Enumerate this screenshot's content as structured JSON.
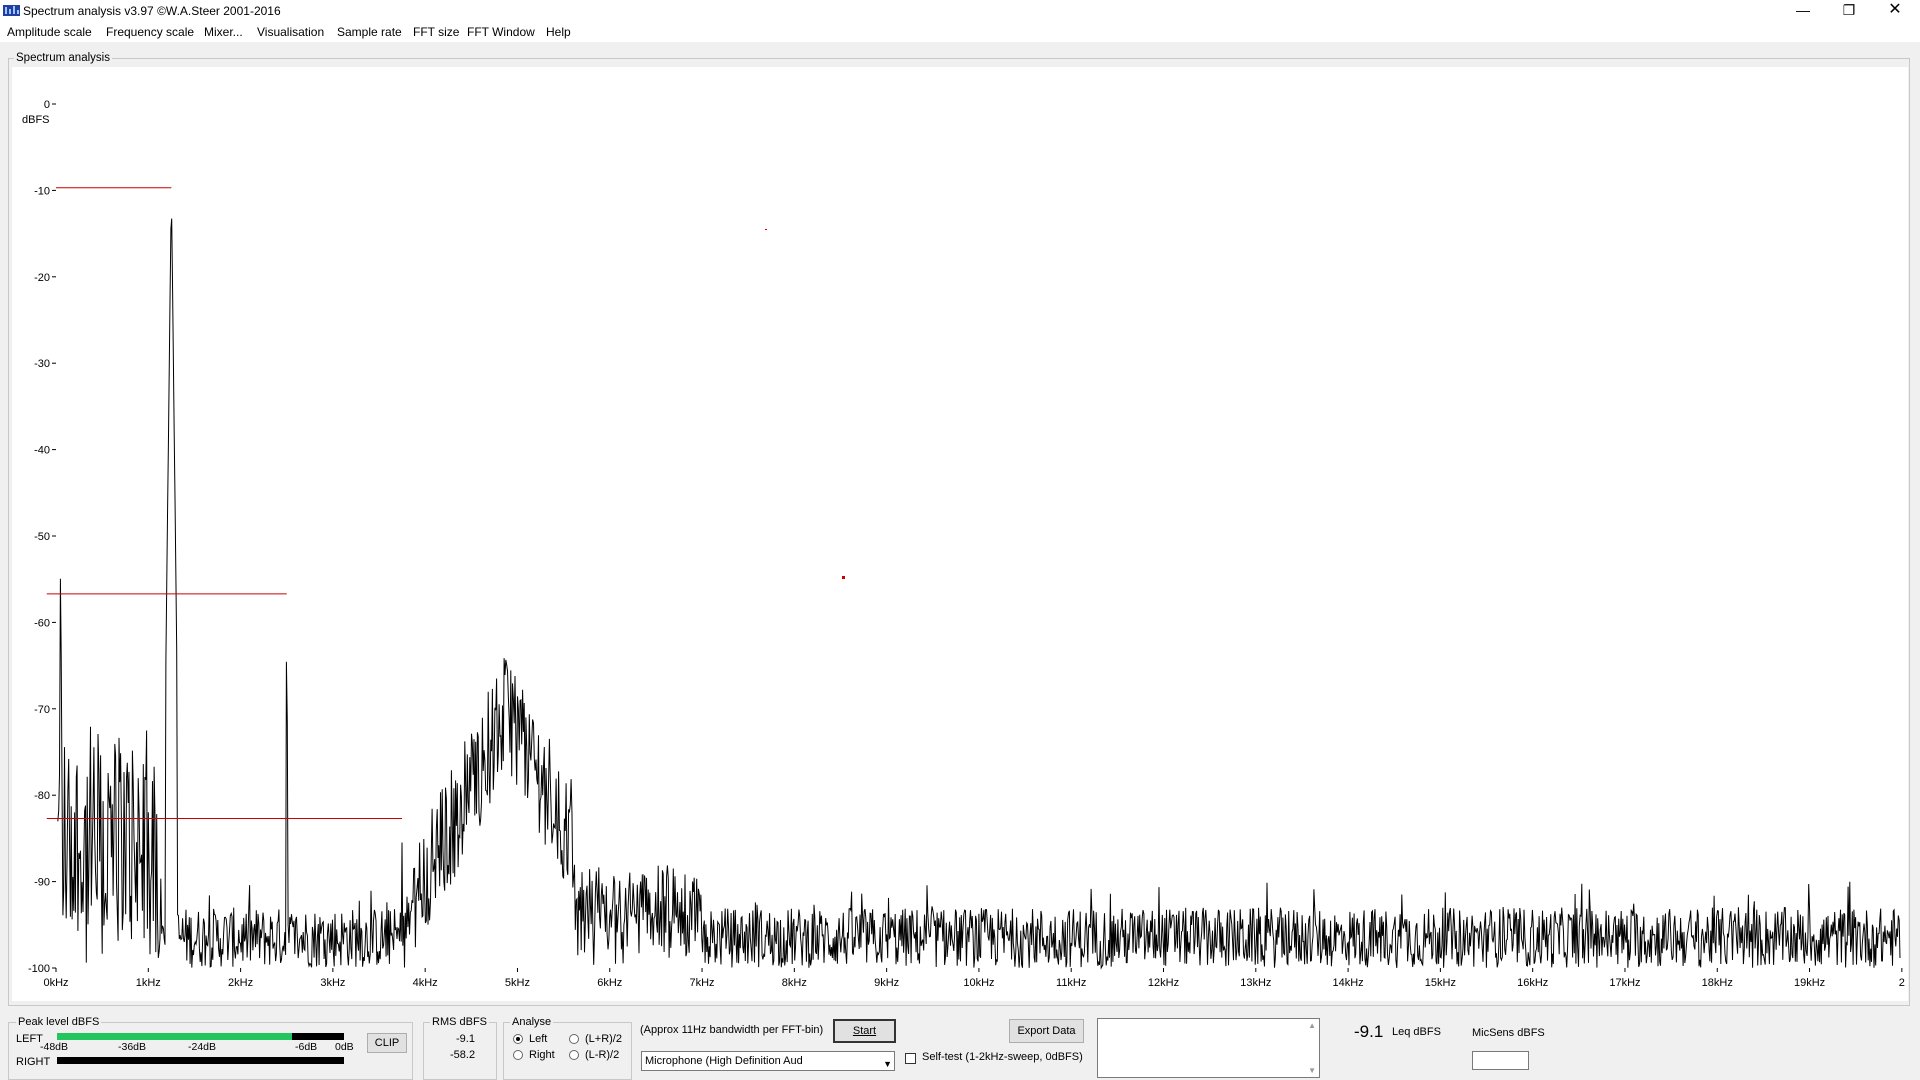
{
  "window": {
    "title": "Spectrum analysis v3.97  ©W.A.Steer 2001-2016",
    "minimize_glyph": "—",
    "maximize_glyph": "❐",
    "close_glyph": "✕"
  },
  "menu": [
    "Amplitude scale",
    "Frequency scale",
    "Mixer...",
    "Visualisation",
    "Sample rate",
    "FFT size",
    "FFT Window",
    "Help"
  ],
  "spectrum_panel": {
    "label": "Spectrum analysis"
  },
  "chart_data": {
    "type": "line",
    "ylabel": "dBFS",
    "ylim": [
      -100,
      0
    ],
    "xlim_khz": [
      0,
      20
    ],
    "y_ticks": [
      "0",
      "-10",
      "-20",
      "-30",
      "-40",
      "-50",
      "-60",
      "-70",
      "-80",
      "-90",
      "-100"
    ],
    "x_ticks": [
      "0kHz",
      "1kHz",
      "2kHz",
      "3kHz",
      "4kHz",
      "5kHz",
      "6kHz",
      "7kHz",
      "8kHz",
      "9kHz",
      "10kHz",
      "11kHz",
      "12kHz",
      "13kHz",
      "14kHz",
      "15kHz",
      "16kHz",
      "17kHz",
      "18kHz",
      "19kHz",
      "2"
    ],
    "peaks": [
      {
        "freq_khz": 0.05,
        "db": -48
      },
      {
        "freq_khz": 1.25,
        "db": -9.7
      },
      {
        "freq_khz": 2.5,
        "db": -56.7
      },
      {
        "freq_khz": 3.75,
        "db": -82.7
      },
      {
        "freq_khz": 4.9,
        "db": -69.5
      }
    ],
    "harmonic_markers": [
      {
        "from_khz": 0.0,
        "to_khz": 1.25,
        "db": -9.7
      },
      {
        "from_khz": -0.1,
        "to_khz": 2.5,
        "db": -56.7
      },
      {
        "from_khz": -0.1,
        "to_khz": 3.75,
        "db": -82.7
      }
    ],
    "noise_floor_db": [
      -100,
      -90
    ],
    "line_color": "#000000",
    "marker_color": "#cc0000"
  },
  "peak_level": {
    "label": "Peak level dBFS",
    "left_label": "LEFT",
    "right_label": "RIGHT",
    "scale": [
      "-48dB",
      "-36dB",
      "-24dB",
      "-6dB",
      "0dB"
    ],
    "left_fill_fraction": 0.82,
    "clip_label": "CLIP",
    "fill_color": "#22c55e"
  },
  "rms": {
    "label": "RMS dBFS",
    "left": "-9.1",
    "right": "-58.2"
  },
  "analyse": {
    "label": "Analyse",
    "options": [
      "Left",
      "Right",
      "(L+R)/2",
      "(L-R)/2"
    ],
    "selected": "Left"
  },
  "fft_note": "(Approx 11Hz bandwidth per FFT-bin)",
  "start_button": "Start",
  "device_select": "Microphone (High Definition Aud",
  "export_button": "Export Data",
  "self_test": {
    "label": "Self-test  (1-2kHz-sweep, 0dBFS)",
    "checked": false
  },
  "leq": {
    "value": "-9.1",
    "label": "Leq dBFS"
  },
  "mic_sens": {
    "label": "MicSens dBFS",
    "value": ""
  }
}
